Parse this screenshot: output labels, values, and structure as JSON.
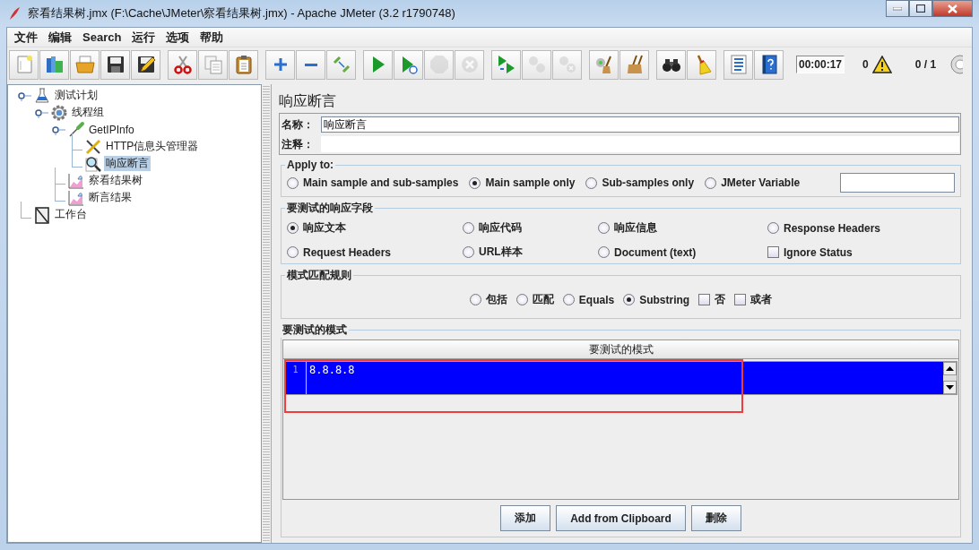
{
  "window": {
    "title": "察看结果树.jmx (F:\\Cache\\JMeter\\察看结果树.jmx) - Apache JMeter (3.2 r1790748)"
  },
  "menu": [
    "文件",
    "编辑",
    "Search",
    "运行",
    "选项",
    "帮助"
  ],
  "toolbar": {
    "groups": [
      [
        {
          "kind": "new",
          "disabled": false
        },
        {
          "kind": "templates",
          "disabled": false
        },
        {
          "kind": "open",
          "disabled": false
        },
        {
          "kind": "save",
          "disabled": false
        },
        {
          "kind": "save-as",
          "disabled": false
        }
      ],
      [
        {
          "kind": "cut",
          "disabled": false
        },
        {
          "kind": "copy",
          "disabled": false
        },
        {
          "kind": "paste",
          "disabled": false
        }
      ],
      [
        {
          "kind": "add",
          "disabled": false
        },
        {
          "kind": "remove",
          "disabled": false
        },
        {
          "kind": "toggle",
          "disabled": false
        }
      ],
      [
        {
          "kind": "start",
          "disabled": false
        },
        {
          "kind": "start-no-pauses",
          "disabled": false
        },
        {
          "kind": "stop",
          "disabled": true
        },
        {
          "kind": "shutdown",
          "disabled": true
        }
      ],
      [
        {
          "kind": "remote-start",
          "disabled": false
        },
        {
          "kind": "remote-stop",
          "disabled": true
        },
        {
          "kind": "remote-shutdown",
          "disabled": true
        }
      ],
      [
        {
          "kind": "clear",
          "disabled": false
        },
        {
          "kind": "clear-all",
          "disabled": false
        }
      ],
      [
        {
          "kind": "search",
          "disabled": false
        },
        {
          "kind": "reset-search",
          "disabled": false
        }
      ],
      [
        {
          "kind": "function-helper",
          "disabled": false
        },
        {
          "kind": "help",
          "disabled": false
        }
      ]
    ],
    "timer": "00:00:17",
    "warnings": "0",
    "threads": "0 / 1"
  },
  "tree": [
    {
      "label": "测试计划",
      "kind": "test-plan",
      "selected": false,
      "expanded": true,
      "children": [
        {
          "label": "线程组",
          "kind": "thread-group",
          "selected": false,
          "expanded": true,
          "children": [
            {
              "label": "GetIPInfo",
              "kind": "sampler",
              "selected": false,
              "expanded": true,
              "children": [
                {
                  "label": "HTTP信息头管理器",
                  "kind": "config",
                  "selected": false
                },
                {
                  "label": "响应断言",
                  "kind": "assertion",
                  "selected": true
                }
              ]
            },
            {
              "label": "察看结果树",
              "kind": "listener",
              "selected": false
            },
            {
              "label": "断言结果",
              "kind": "listener",
              "selected": false
            }
          ]
        }
      ]
    },
    {
      "label": "工作台",
      "kind": "workbench",
      "selected": false
    }
  ],
  "panel": {
    "title": "响应断言",
    "name_label": "名称：",
    "name_value": "响应断言",
    "comment_label": "注释：",
    "apply_to": {
      "title": "Apply to:",
      "options": [
        {
          "label": "Main sample and sub-samples",
          "selected": false
        },
        {
          "label": "Main sample only",
          "selected": true
        },
        {
          "label": "Sub-samples only",
          "selected": false
        },
        {
          "label": "JMeter Variable",
          "selected": false
        }
      ]
    },
    "fields": {
      "title": "要测试的响应字段",
      "options": [
        {
          "kind": "radio",
          "label": "响应文本",
          "selected": true
        },
        {
          "kind": "radio",
          "label": "响应代码",
          "selected": false
        },
        {
          "kind": "radio",
          "label": "响应信息",
          "selected": false
        },
        {
          "kind": "radio",
          "label": "Response Headers",
          "selected": false
        },
        {
          "kind": "radio",
          "label": "Request Headers",
          "selected": false
        },
        {
          "kind": "radio",
          "label": "URL样本",
          "selected": false
        },
        {
          "kind": "radio",
          "label": "Document (text)",
          "selected": false
        },
        {
          "kind": "checkbox",
          "label": "Ignore Status",
          "checked": false
        }
      ]
    },
    "matching": {
      "title": "模式匹配规则",
      "options": [
        {
          "kind": "radio",
          "label": "包括",
          "selected": false
        },
        {
          "kind": "radio",
          "label": "匹配",
          "selected": false
        },
        {
          "kind": "radio",
          "label": "Equals",
          "selected": false
        },
        {
          "kind": "radio",
          "label": "Substring",
          "selected": true
        },
        {
          "kind": "checkbox",
          "label": "否",
          "checked": false
        },
        {
          "kind": "checkbox",
          "label": "或者",
          "checked": false
        }
      ]
    },
    "patterns": {
      "title": "要测试的模式",
      "column": "要测试的模式",
      "rows": [
        {
          "number": "1",
          "value": "8.8.8.8",
          "selected": true
        }
      ]
    },
    "buttons": [
      "添加",
      "Add from Clipboard",
      "删除"
    ]
  }
}
